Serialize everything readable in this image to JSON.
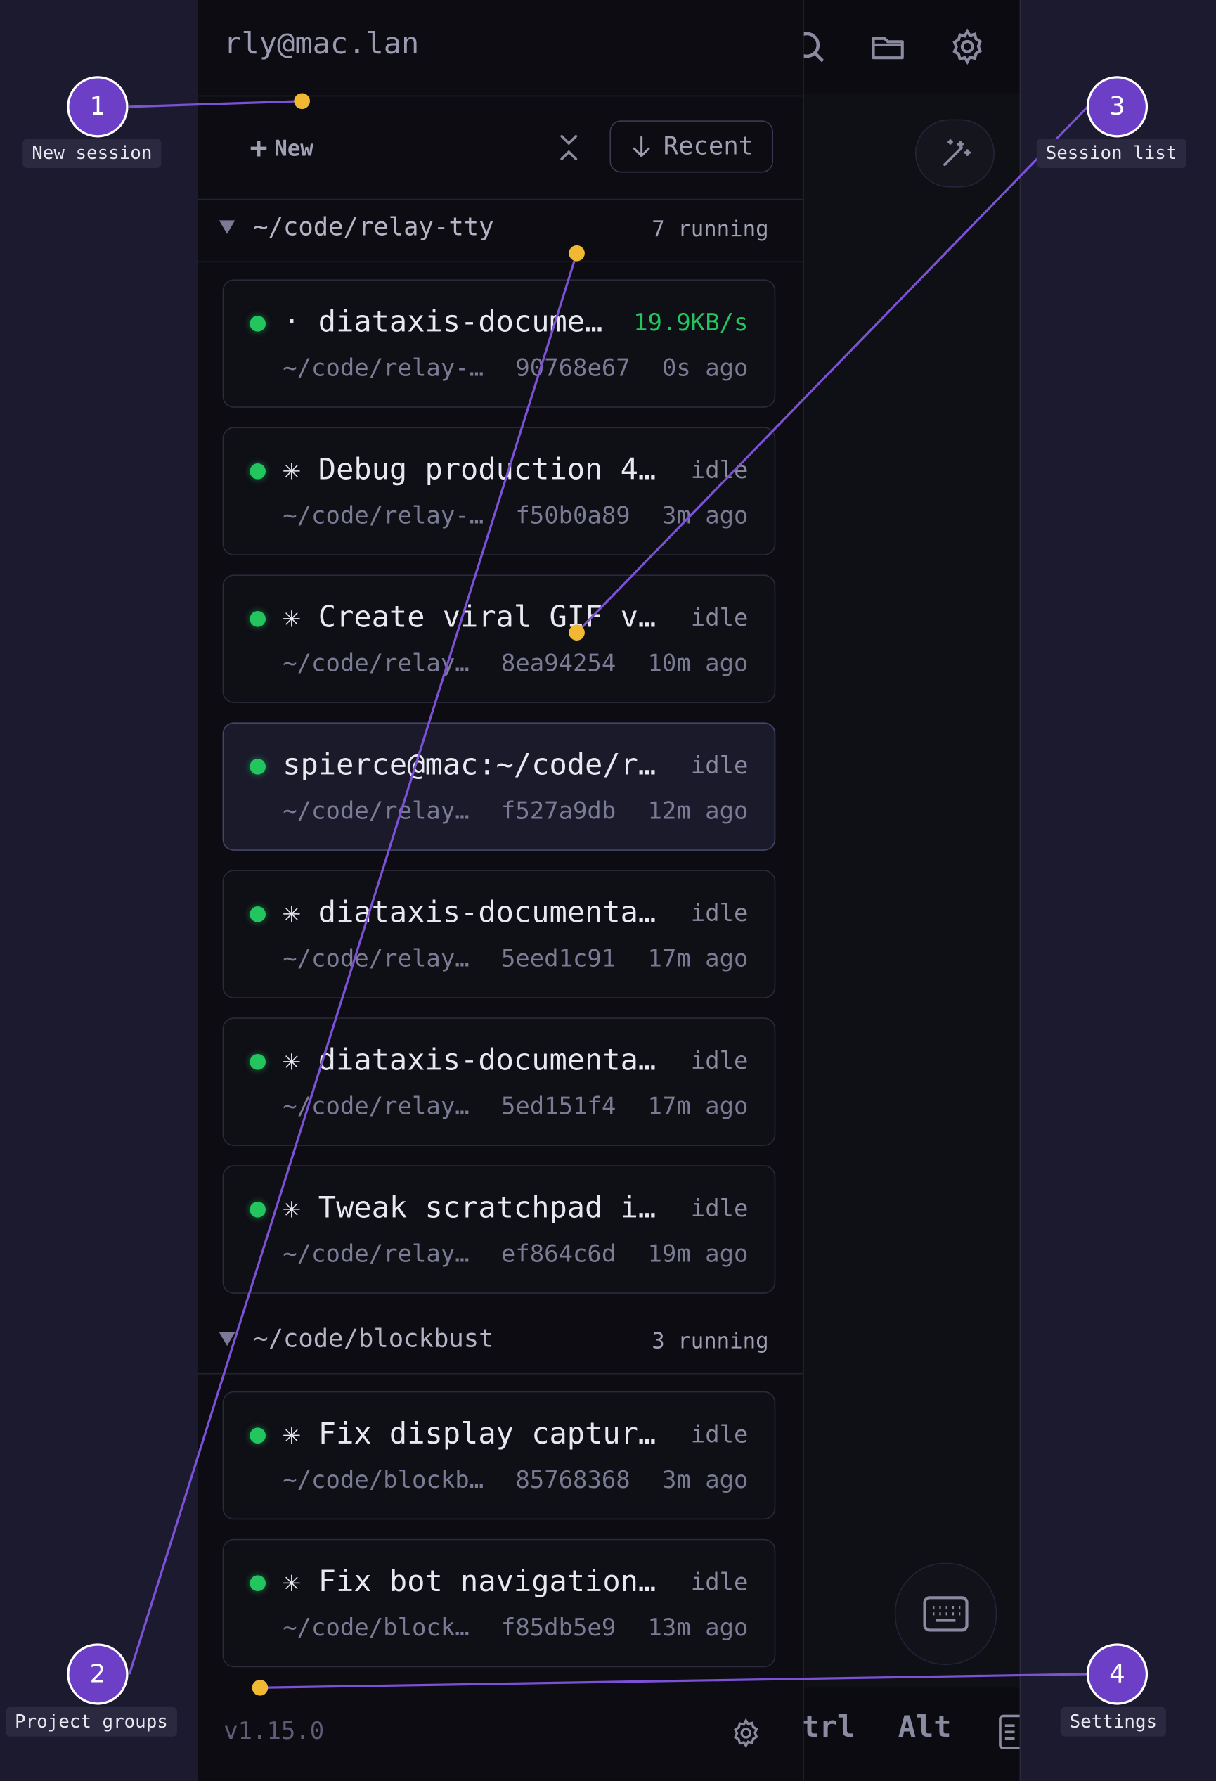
{
  "header": {
    "host": "rly@mac.lan"
  },
  "toolbar": {
    "new_label": "New",
    "recent_label": "Recent"
  },
  "groups": [
    {
      "path": "~/code/relay-tty",
      "count": "7 running"
    },
    {
      "path": "~/code/blockbust",
      "count": "3 running"
    }
  ],
  "sessions": [
    {
      "title": "· diataxis-docume…",
      "status": "19.9KB/s",
      "path": "~/code/relay-…",
      "hash": "90768e67",
      "age": "0s ago"
    },
    {
      "title": "✳ Debug production 4…",
      "status": "idle",
      "path": "~/code/relay-…",
      "hash": "f50b0a89",
      "age": "3m ago"
    },
    {
      "title": "✳ Create viral GIF v…",
      "status": "idle",
      "path": "~/code/relay…",
      "hash": "8ea94254",
      "age": "10m ago"
    },
    {
      "title": "spierce@mac:~/code/r…",
      "status": "idle",
      "path": "~/code/relay…",
      "hash": "f527a9db",
      "age": "12m ago"
    },
    {
      "title": "✳ diataxis-documenta…",
      "status": "idle",
      "path": "~/code/relay…",
      "hash": "5eed1c91",
      "age": "17m ago"
    },
    {
      "title": "✳ diataxis-documenta…",
      "status": "idle",
      "path": "~/code/relay…",
      "hash": "5ed151f4",
      "age": "17m ago"
    },
    {
      "title": "✳ Tweak scratchpad i…",
      "status": "idle",
      "path": "~/code/relay…",
      "hash": "ef864c6d",
      "age": "19m ago"
    },
    {
      "title": "✳ Fix display captur…",
      "status": "idle",
      "path": "~/code/blockb…",
      "hash": "85768368",
      "age": "3m ago"
    },
    {
      "title": "✳ Fix bot navigation…",
      "status": "idle",
      "path": "~/code/block…",
      "hash": "f85db5e9",
      "age": "13m ago"
    }
  ],
  "footer": {
    "version": "v1.15.0"
  },
  "keys": {
    "ctrl": "trl",
    "alt": "Alt"
  },
  "annotations": [
    {
      "number": "1",
      "label": "New session"
    },
    {
      "number": "2",
      "label": "Project groups"
    },
    {
      "number": "3",
      "label": "Session list"
    },
    {
      "number": "4",
      "label": "Settings"
    }
  ],
  "colors": {
    "accent": "#6d3fc7",
    "running": "#22c55e",
    "marker": "#f0b833"
  }
}
